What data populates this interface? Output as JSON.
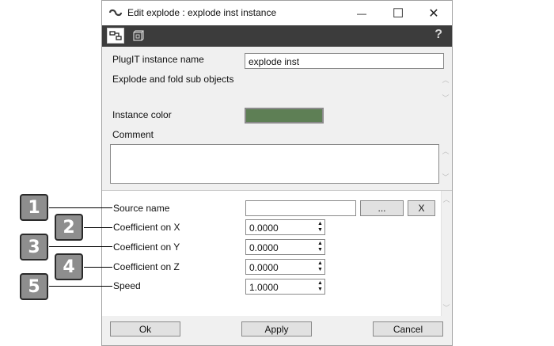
{
  "window": {
    "title": "Edit explode : explode inst instance",
    "controls": {
      "minimize": "—",
      "maximize": "☐",
      "close": "✕"
    }
  },
  "toolbar": {
    "buttons": [
      {
        "icon": "plugit-graph-icon",
        "active": true
      },
      {
        "icon": "cube-object-icon",
        "active": false
      }
    ],
    "help_label": "?"
  },
  "instance": {
    "name_label": "PlugIT instance name",
    "name_value": "explode inst",
    "description": "Explode and fold sub objects",
    "color_label": "Instance color",
    "color_value": "#5e7f55",
    "comment_label": "Comment",
    "comment_value": ""
  },
  "params": {
    "source": {
      "label": "Source name",
      "value": "",
      "browse_label": "...",
      "clear_label": "X"
    },
    "coef_x": {
      "label": "Coefficient on X",
      "value": "0.0000"
    },
    "coef_y": {
      "label": "Coefficient on Y",
      "value": "0.0000"
    },
    "coef_z": {
      "label": "Coefficient on Z",
      "value": "0.0000"
    },
    "speed": {
      "label": "Speed",
      "value": "1.0000"
    }
  },
  "callouts": [
    "1",
    "2",
    "3",
    "4",
    "5"
  ],
  "footer": {
    "ok": "Ok",
    "apply": "Apply",
    "cancel": "Cancel"
  }
}
